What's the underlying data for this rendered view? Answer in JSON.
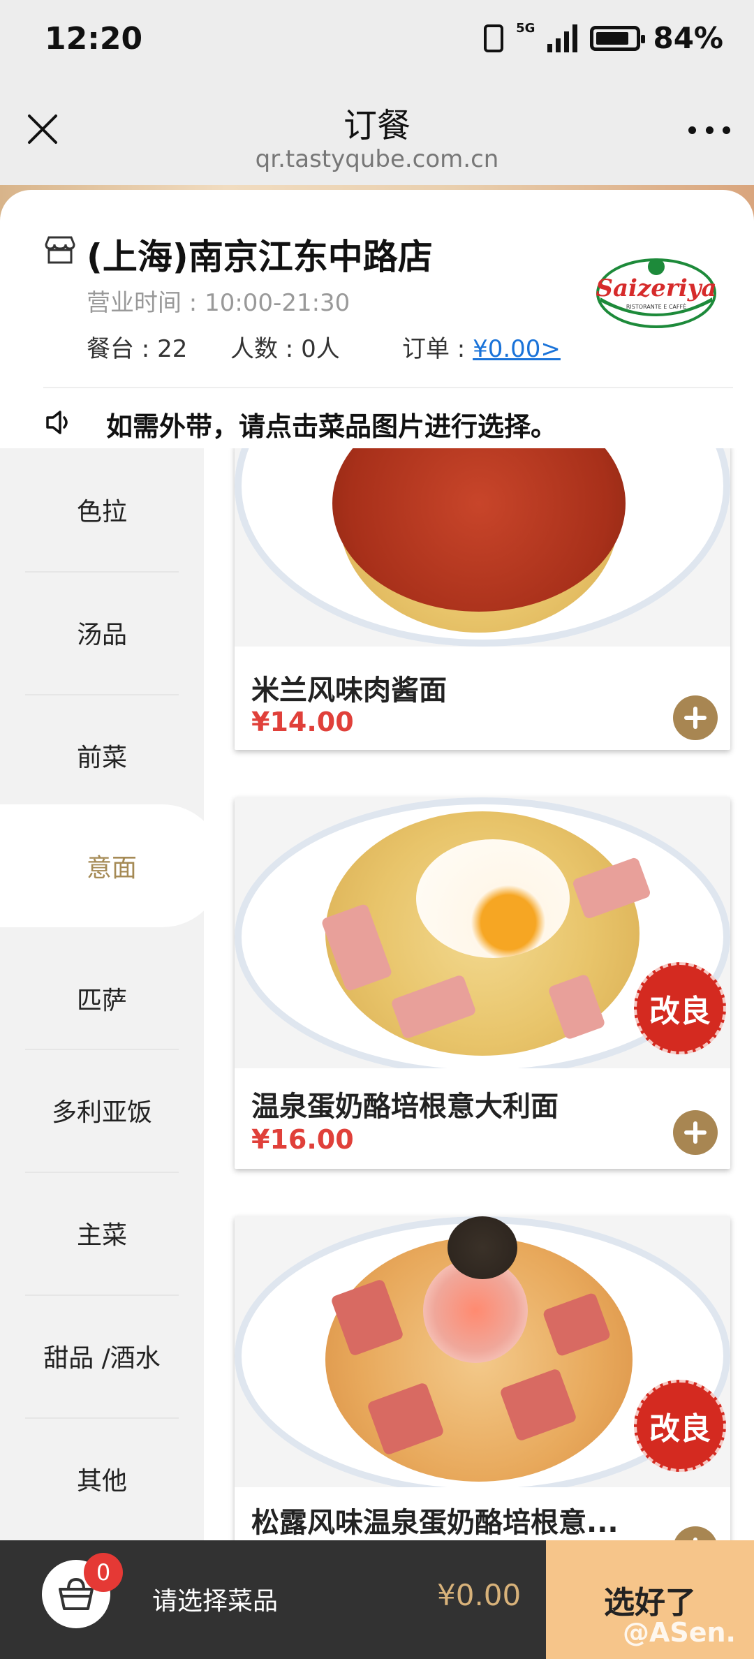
{
  "status_bar": {
    "time": "12:20",
    "network": "5G",
    "battery": "84%"
  },
  "nav": {
    "title": "订餐",
    "url": "qr.tastyqube.com.cn"
  },
  "shop": {
    "name": "(上海)南京江东中路店",
    "hours": "营业时间 : 10:00-21:30",
    "table": "餐台 : 22",
    "people": "人数 : 0人",
    "order_label": "订单 : ",
    "order_amount": "¥0.00>",
    "logo_text": "Saizeriya",
    "logo_sub": "RISTORANTE E CAFFÈ"
  },
  "notice": "如需外带，请点击菜品图片进行选择。",
  "categories": [
    "色拉",
    "汤品",
    "前菜",
    "意面",
    "匹萨",
    "多利亚饭",
    "主菜",
    "甜品 /酒水",
    "其他"
  ],
  "active_category": "意面",
  "dishes": [
    {
      "name": "米兰风味肉酱面",
      "price": "¥14.00",
      "badge": ""
    },
    {
      "name": "温泉蛋奶酪培根意大利面",
      "price": "¥16.00",
      "badge": "改良"
    },
    {
      "name": "松露风味温泉蛋奶酪培根意...",
      "price": "",
      "badge": "改良"
    }
  ],
  "cart": {
    "count": "0",
    "hint": "请选择菜品",
    "total": "¥0.00",
    "submit": "选好了"
  },
  "watermark": "@ASen.",
  "colors": {
    "accent": "#a88652",
    "price": "#e0403a",
    "submit": "#f6c58a",
    "link": "#1a73d9"
  }
}
